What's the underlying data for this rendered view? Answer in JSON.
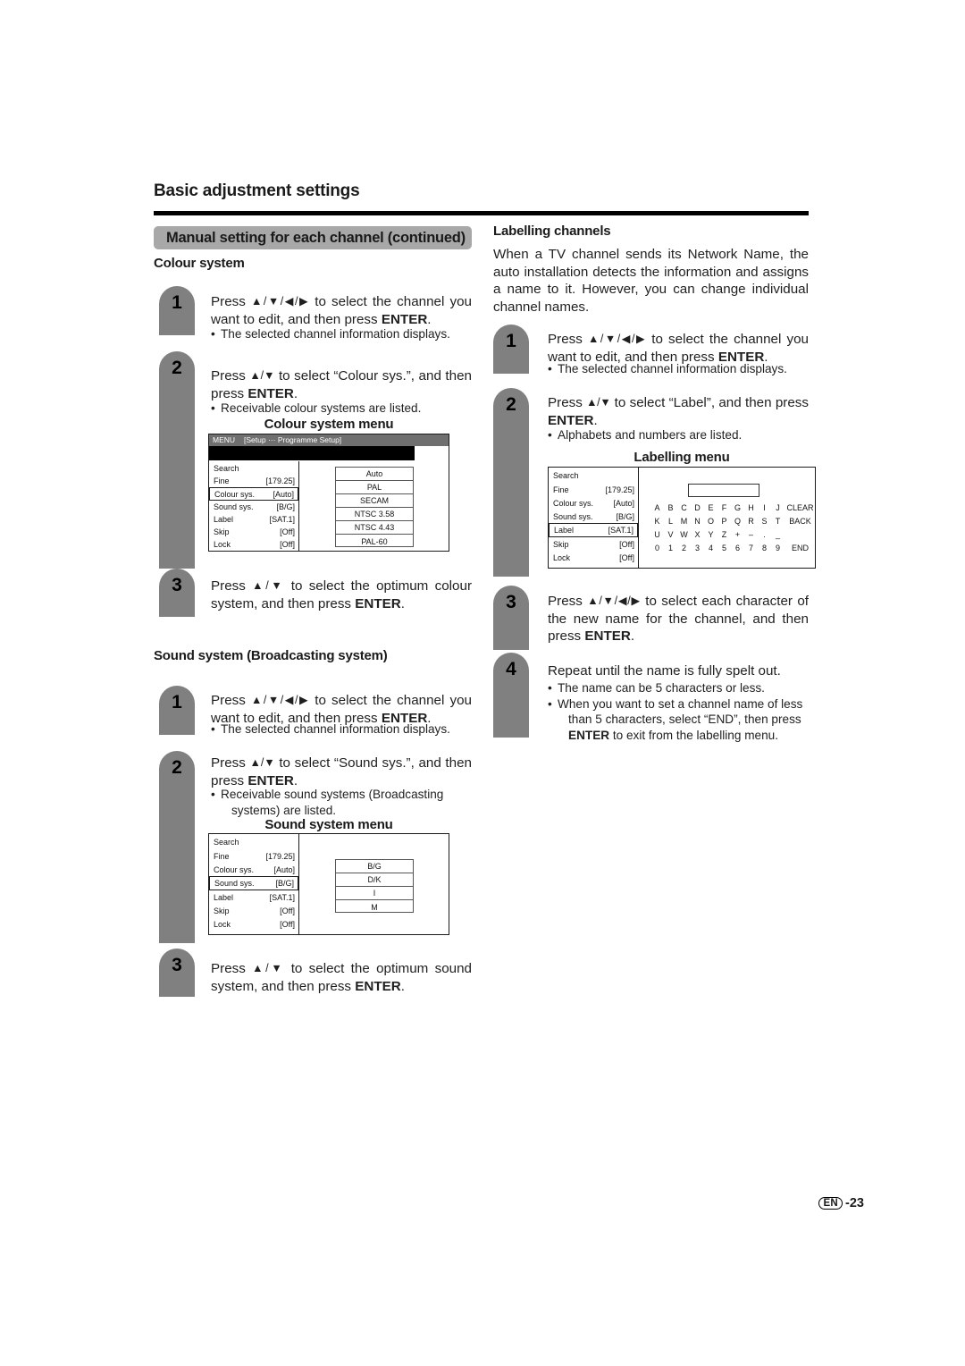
{
  "header": {
    "page_title": "Basic adjustment settings",
    "section_banner": "Manual setting for each channel (continued)"
  },
  "left_column": {
    "colour_system": {
      "heading": "Colour system",
      "steps": [
        {
          "num": "1",
          "text_parts": [
            "Press ",
            "▲/▼/◀/▶",
            " to select the channel you want to edit, and then press ",
            "ENTER",
            "."
          ],
          "bullets": [
            "The selected channel information displays."
          ]
        },
        {
          "num": "2",
          "text_parts": [
            "Press ",
            "▲/▼",
            " to select “Colour sys.”, and then press ",
            "ENTER",
            "."
          ],
          "bullets": [
            "Receivable colour systems are listed."
          ]
        },
        {
          "num": "3",
          "text_parts": [
            "Press ",
            "▲/▼",
            " to select the optimum colour system, and then press ",
            "ENTER",
            "."
          ],
          "bullets": []
        }
      ],
      "menu": {
        "title": "Colour system menu",
        "menubar_label": "MENU",
        "menubar_path": "[Setup ··· Programme Setup]",
        "rows": [
          {
            "key": "Search",
            "value": "",
            "selected": false
          },
          {
            "key": "Fine",
            "value": "[179.25]",
            "selected": false
          },
          {
            "key": "Colour sys.",
            "value": "[Auto]",
            "selected": true
          },
          {
            "key": "Sound sys.",
            "value": "[B/G]",
            "selected": false
          },
          {
            "key": "Label",
            "value": "[SAT.1]",
            "selected": false
          },
          {
            "key": "Skip",
            "value": "[Off]",
            "selected": false
          },
          {
            "key": "Lock",
            "value": "[Off]",
            "selected": false
          }
        ],
        "options": [
          "Auto",
          "PAL",
          "SECAM",
          "NTSC 3.58",
          "NTSC 4.43",
          "PAL-60"
        ]
      }
    },
    "sound_system": {
      "heading": "Sound system (Broadcasting system)",
      "steps": [
        {
          "num": "1",
          "text_parts": [
            "Press ",
            "▲/▼/◀/▶",
            " to select the channel you want to edit, and then press ",
            "ENTER",
            "."
          ],
          "bullets": [
            "The selected channel information displays."
          ]
        },
        {
          "num": "2",
          "text_parts": [
            "Press ",
            "▲/▼",
            " to select “Sound sys.”, and then press ",
            "ENTER",
            "."
          ],
          "bullets": [
            "Receivable sound systems (Broadcasting",
            "systems) are listed."
          ]
        },
        {
          "num": "3",
          "text_parts": [
            "Press ",
            "▲/▼",
            " to select the optimum sound system, and then press ",
            "ENTER",
            "."
          ],
          "bullets": []
        }
      ],
      "menu": {
        "title": "Sound system menu",
        "rows": [
          {
            "key": "Search",
            "value": "",
            "selected": false
          },
          {
            "key": "Fine",
            "value": "[179.25]",
            "selected": false
          },
          {
            "key": "Colour sys.",
            "value": "[Auto]",
            "selected": false
          },
          {
            "key": "Sound sys.",
            "value": "[B/G]",
            "selected": true
          },
          {
            "key": "Label",
            "value": "[SAT.1]",
            "selected": false
          },
          {
            "key": "Skip",
            "value": "[Off]",
            "selected": false
          },
          {
            "key": "Lock",
            "value": "[Off]",
            "selected": false
          }
        ],
        "options": [
          "B/G",
          "D/K",
          "I",
          "M"
        ]
      }
    }
  },
  "right_column": {
    "labelling": {
      "heading": "Labelling channels",
      "intro": "When a TV channel sends its Network Name, the auto installation detects the information and assigns a name to it. However, you can change individual channel names.",
      "steps": [
        {
          "num": "1",
          "text_parts": [
            "Press ",
            "▲/▼/◀/▶",
            " to select the channel you want to edit, and then press ",
            "ENTER",
            "."
          ],
          "bullets": [
            "The selected channel information displays."
          ]
        },
        {
          "num": "2",
          "text_parts": [
            "Press ",
            "▲/▼",
            " to select “Label”, and then press ",
            "ENTER",
            "."
          ],
          "bullets": [
            "Alphabets and numbers are listed."
          ]
        },
        {
          "num": "3",
          "text_parts": [
            "Press ",
            "▲/▼/◀/▶",
            " to select each character of the new name for the channel, and then press ",
            "ENTER",
            "."
          ],
          "bullets": []
        },
        {
          "num": "4",
          "text_parts": [
            "Repeat until the name is fully spelt out."
          ],
          "bullets": [
            "The name can be 5 characters or less.",
            "When you want to set a channel name of less",
            "than 5 characters, select “END”, then press",
            "ENTER to exit from the labelling menu."
          ]
        }
      ],
      "menu": {
        "title": "Labelling menu",
        "rows": [
          {
            "key": "Search",
            "value": "",
            "selected": false
          },
          {
            "key": "Fine",
            "value": "[179.25]",
            "selected": false
          },
          {
            "key": "Colour sys.",
            "value": "[Auto]",
            "selected": false
          },
          {
            "key": "Sound sys.",
            "value": "[B/G]",
            "selected": false
          },
          {
            "key": "Label",
            "value": "[SAT.1]",
            "selected": true
          },
          {
            "key": "Skip",
            "value": "[Off]",
            "selected": false
          },
          {
            "key": "Lock",
            "value": "[Off]",
            "selected": false
          }
        ],
        "name_field_value": "",
        "char_rows": [
          [
            "A",
            "B",
            "C",
            "D",
            "E",
            "F",
            "G",
            "H",
            "I",
            "J",
            "CLEAR"
          ],
          [
            "K",
            "L",
            "M",
            "N",
            "O",
            "P",
            "Q",
            "R",
            "S",
            "T",
            "BACK"
          ],
          [
            "U",
            "V",
            "W",
            "X",
            "Y",
            "Z",
            "+",
            "–",
            ".",
            "_",
            ""
          ],
          [
            "0",
            "1",
            "2",
            "3",
            "4",
            "5",
            "6",
            "7",
            "8",
            "9",
            "END"
          ]
        ]
      }
    }
  },
  "footer": {
    "language_code": "EN",
    "page_number": "-23"
  },
  "colors": {
    "step_bar": "#808080",
    "banner": "#a8a8a8",
    "menubar": "#6f6f6f",
    "rule": "#000000"
  }
}
